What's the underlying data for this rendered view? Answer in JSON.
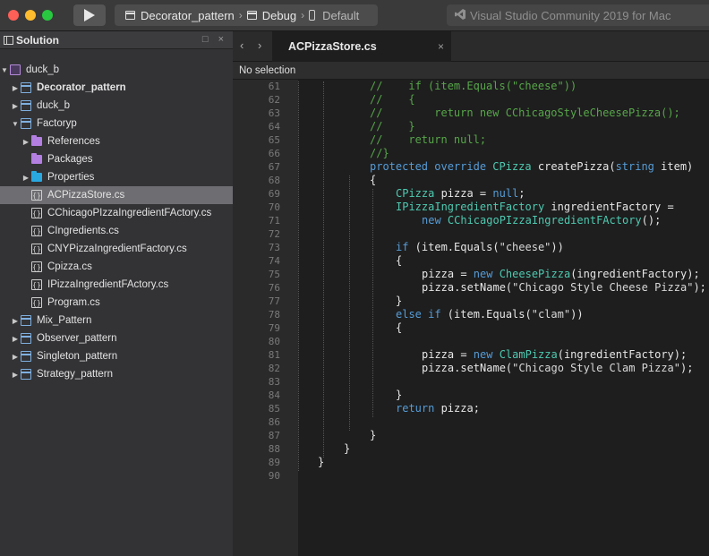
{
  "titlebar": {
    "breadcrumb": {
      "project": "Decorator_pattern",
      "config": "Debug",
      "device": "Default"
    },
    "app_title": "Visual Studio Community 2019 for Mac",
    "app_icon": "visual-studio-icon"
  },
  "sidebar": {
    "title": "Solution",
    "controls": "□ ×",
    "items": [
      {
        "label": "duck_b",
        "icon": "solution-icon",
        "arrow": "▼",
        "depth": 0,
        "bold": false,
        "selected": false
      },
      {
        "label": "Decorator_pattern",
        "icon": "project-icon",
        "arrow": "▶",
        "depth": 1,
        "bold": true,
        "selected": false
      },
      {
        "label": "duck_b",
        "icon": "project-icon",
        "arrow": "▶",
        "depth": 1,
        "bold": false,
        "selected": false
      },
      {
        "label": "Factoryp",
        "icon": "project-icon",
        "arrow": "▼",
        "depth": 1,
        "bold": false,
        "selected": false
      },
      {
        "label": "References",
        "icon": "references-folder-icon",
        "arrow": "▶",
        "depth": 2,
        "bold": false,
        "selected": false
      },
      {
        "label": "Packages",
        "icon": "packages-folder-icon",
        "arrow": "",
        "depth": 2,
        "bold": false,
        "selected": false
      },
      {
        "label": "Properties",
        "icon": "properties-folder-icon",
        "arrow": "▶",
        "depth": 2,
        "bold": false,
        "selected": false
      },
      {
        "label": "ACPizzaStore.cs",
        "icon": "csharp-file-icon",
        "arrow": "",
        "depth": 2,
        "bold": false,
        "selected": true
      },
      {
        "label": "CChicagoPIzzaIngredientFActory.cs",
        "icon": "csharp-file-icon",
        "arrow": "",
        "depth": 2,
        "bold": false,
        "selected": false
      },
      {
        "label": "CIngredients.cs",
        "icon": "csharp-file-icon",
        "arrow": "",
        "depth": 2,
        "bold": false,
        "selected": false
      },
      {
        "label": "CNYPizzaIngredientFactory.cs",
        "icon": "csharp-file-icon",
        "arrow": "",
        "depth": 2,
        "bold": false,
        "selected": false
      },
      {
        "label": "Cpizza.cs",
        "icon": "csharp-file-icon",
        "arrow": "",
        "depth": 2,
        "bold": false,
        "selected": false
      },
      {
        "label": "IPizzaIngredientFActory.cs",
        "icon": "csharp-file-icon",
        "arrow": "",
        "depth": 2,
        "bold": false,
        "selected": false
      },
      {
        "label": "Program.cs",
        "icon": "csharp-file-icon",
        "arrow": "",
        "depth": 2,
        "bold": false,
        "selected": false
      },
      {
        "label": "Mix_Pattern",
        "icon": "project-icon",
        "arrow": "▶",
        "depth": 1,
        "bold": false,
        "selected": false
      },
      {
        "label": "Observer_pattern",
        "icon": "project-icon",
        "arrow": "▶",
        "depth": 1,
        "bold": false,
        "selected": false
      },
      {
        "label": "Singleton_pattern",
        "icon": "project-icon",
        "arrow": "▶",
        "depth": 1,
        "bold": false,
        "selected": false
      },
      {
        "label": "Strategy_pattern",
        "icon": "project-icon",
        "arrow": "▶",
        "depth": 1,
        "bold": false,
        "selected": false
      }
    ]
  },
  "editor": {
    "tab_label": "ACPizzaStore.cs",
    "tab_close": "×",
    "nav_back": "‹",
    "nav_forward": "›",
    "selection_status": "No selection",
    "lines": [
      {
        "n": 61,
        "indent": 9,
        "tokens": [
          {
            "c": "c",
            "t": "//    if (item.Equals(\"cheese\"))"
          }
        ]
      },
      {
        "n": 62,
        "indent": 9,
        "tokens": [
          {
            "c": "c",
            "t": "//    {"
          }
        ]
      },
      {
        "n": 63,
        "indent": 9,
        "tokens": [
          {
            "c": "c",
            "t": "//        return new CChicagoStyleCheesePizza();"
          }
        ]
      },
      {
        "n": 64,
        "indent": 9,
        "tokens": [
          {
            "c": "c",
            "t": "//    }"
          }
        ]
      },
      {
        "n": 65,
        "indent": 9,
        "tokens": [
          {
            "c": "c",
            "t": "//    return null;"
          }
        ]
      },
      {
        "n": 66,
        "indent": 9,
        "tokens": [
          {
            "c": "c",
            "t": "//}"
          }
        ]
      },
      {
        "n": 67,
        "indent": 9,
        "tokens": [
          {
            "c": "k",
            "t": "protected override "
          },
          {
            "c": "t",
            "t": "CPizza"
          },
          {
            "c": "",
            "t": " createPizza("
          },
          {
            "c": "k",
            "t": "string"
          },
          {
            "c": "",
            "t": " item)"
          }
        ]
      },
      {
        "n": 68,
        "indent": 9,
        "tokens": [
          {
            "c": "",
            "t": "{"
          }
        ]
      },
      {
        "n": 69,
        "indent": 13,
        "tokens": [
          {
            "c": "t",
            "t": "CPizza"
          },
          {
            "c": "",
            "t": " pizza = "
          },
          {
            "c": "k",
            "t": "null"
          },
          {
            "c": "",
            "t": ";"
          }
        ]
      },
      {
        "n": 70,
        "indent": 13,
        "tokens": [
          {
            "c": "t",
            "t": "IPizzaIngredientFactory"
          },
          {
            "c": "",
            "t": " ingredientFactory ="
          }
        ]
      },
      {
        "n": 71,
        "indent": 17,
        "tokens": [
          {
            "c": "k",
            "t": "new "
          },
          {
            "c": "t",
            "t": "CChicagoPIzzaIngredientFActory"
          },
          {
            "c": "",
            "t": "();"
          }
        ]
      },
      {
        "n": 72,
        "indent": 0,
        "tokens": []
      },
      {
        "n": 73,
        "indent": 13,
        "tokens": [
          {
            "c": "k",
            "t": "if"
          },
          {
            "c": "",
            "t": " (item.Equals("
          },
          {
            "c": "s",
            "t": "\"cheese\""
          },
          {
            "c": "",
            "t": "))"
          }
        ]
      },
      {
        "n": 74,
        "indent": 13,
        "tokens": [
          {
            "c": "",
            "t": "{"
          }
        ]
      },
      {
        "n": 75,
        "indent": 17,
        "tokens": [
          {
            "c": "",
            "t": "pizza = "
          },
          {
            "c": "k",
            "t": "new "
          },
          {
            "c": "t",
            "t": "CheesePizza"
          },
          {
            "c": "",
            "t": "(ingredientFactory);"
          }
        ]
      },
      {
        "n": 76,
        "indent": 17,
        "tokens": [
          {
            "c": "",
            "t": "pizza.setName("
          },
          {
            "c": "s",
            "t": "\"Chicago Style Cheese Pizza\""
          },
          {
            "c": "",
            "t": ");"
          }
        ]
      },
      {
        "n": 77,
        "indent": 13,
        "tokens": [
          {
            "c": "",
            "t": "}"
          }
        ]
      },
      {
        "n": 78,
        "indent": 13,
        "tokens": [
          {
            "c": "k",
            "t": "else if"
          },
          {
            "c": "",
            "t": " (item.Equals("
          },
          {
            "c": "s",
            "t": "\"clam\""
          },
          {
            "c": "",
            "t": "))"
          }
        ]
      },
      {
        "n": 79,
        "indent": 13,
        "tokens": [
          {
            "c": "",
            "t": "{"
          }
        ]
      },
      {
        "n": 80,
        "indent": 0,
        "tokens": []
      },
      {
        "n": 81,
        "indent": 17,
        "tokens": [
          {
            "c": "",
            "t": "pizza = "
          },
          {
            "c": "k",
            "t": "new "
          },
          {
            "c": "t",
            "t": "ClamPizza"
          },
          {
            "c": "",
            "t": "(ingredientFactory);"
          }
        ]
      },
      {
        "n": 82,
        "indent": 17,
        "tokens": [
          {
            "c": "",
            "t": "pizza.setName("
          },
          {
            "c": "s",
            "t": "\"Chicago Style Clam Pizza\""
          },
          {
            "c": "",
            "t": ");"
          }
        ]
      },
      {
        "n": 83,
        "indent": 0,
        "tokens": []
      },
      {
        "n": 84,
        "indent": 13,
        "tokens": [
          {
            "c": "",
            "t": "}"
          }
        ]
      },
      {
        "n": 85,
        "indent": 13,
        "tokens": [
          {
            "c": "k",
            "t": "return"
          },
          {
            "c": "",
            "t": " pizza;"
          }
        ]
      },
      {
        "n": 86,
        "indent": 0,
        "tokens": []
      },
      {
        "n": 87,
        "indent": 9,
        "tokens": [
          {
            "c": "",
            "t": "}"
          }
        ]
      },
      {
        "n": 88,
        "indent": 5,
        "tokens": [
          {
            "c": "",
            "t": "}"
          }
        ]
      },
      {
        "n": 89,
        "indent": 1,
        "tokens": [
          {
            "c": "",
            "t": "}"
          }
        ]
      },
      {
        "n": 90,
        "indent": 0,
        "tokens": []
      }
    ]
  },
  "colors": {
    "comment": "#57a64a",
    "keyword": "#569cd6",
    "type": "#4ec9b0",
    "selection_row": "#6e6e72",
    "traffic_red": "#fe5f57",
    "traffic_yellow": "#febc2e",
    "traffic_green": "#28c840"
  }
}
